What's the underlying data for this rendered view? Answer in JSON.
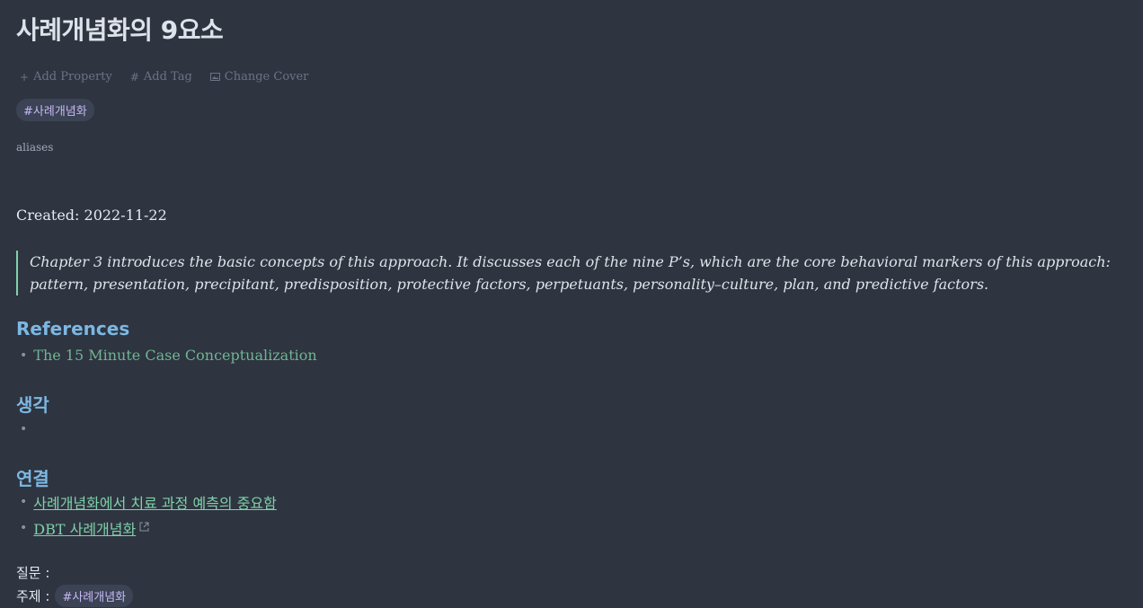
{
  "title": "사례개념화의 9요소",
  "meta_actions": {
    "add_property": "Add Property",
    "add_tag": "Add Tag",
    "change_cover": "Change Cover"
  },
  "tag": "#사례개념화",
  "aliases_label": "aliases",
  "created": "Created: 2022-11-22",
  "quote": "Chapter 3 introduces the basic concepts of this approach. It discusses each of the nine P’s, which are the core behavioral markers of this approach: pattern, presentation, precipitant, predisposition, protective factors, perpetuants, personality–culture, plan, and predictive factors.",
  "sections": {
    "references": {
      "heading": "References",
      "items": [
        "The 15 Minute Case Conceptualization"
      ]
    },
    "thoughts": {
      "heading": "생각",
      "items": [
        ""
      ]
    },
    "connections": {
      "heading": "연결",
      "items": [
        "사례개념화에서 치료 과정 예측의 중요함",
        "DBT 사례개념화"
      ]
    }
  },
  "question_label": "질문 :",
  "topic_label": "주제 :",
  "topic_tag": "#사례개념화",
  "icons": {
    "add_property": "plus-icon",
    "add_tag": "hash-icon",
    "change_cover": "image-icon",
    "external": "external-link-icon"
  },
  "colors": {
    "background": "#2e3440",
    "heading": "#7cb8e3",
    "link": "#7fd1a9",
    "tag_text": "#c6b8f2",
    "quote_border": "#7fd1a9"
  }
}
